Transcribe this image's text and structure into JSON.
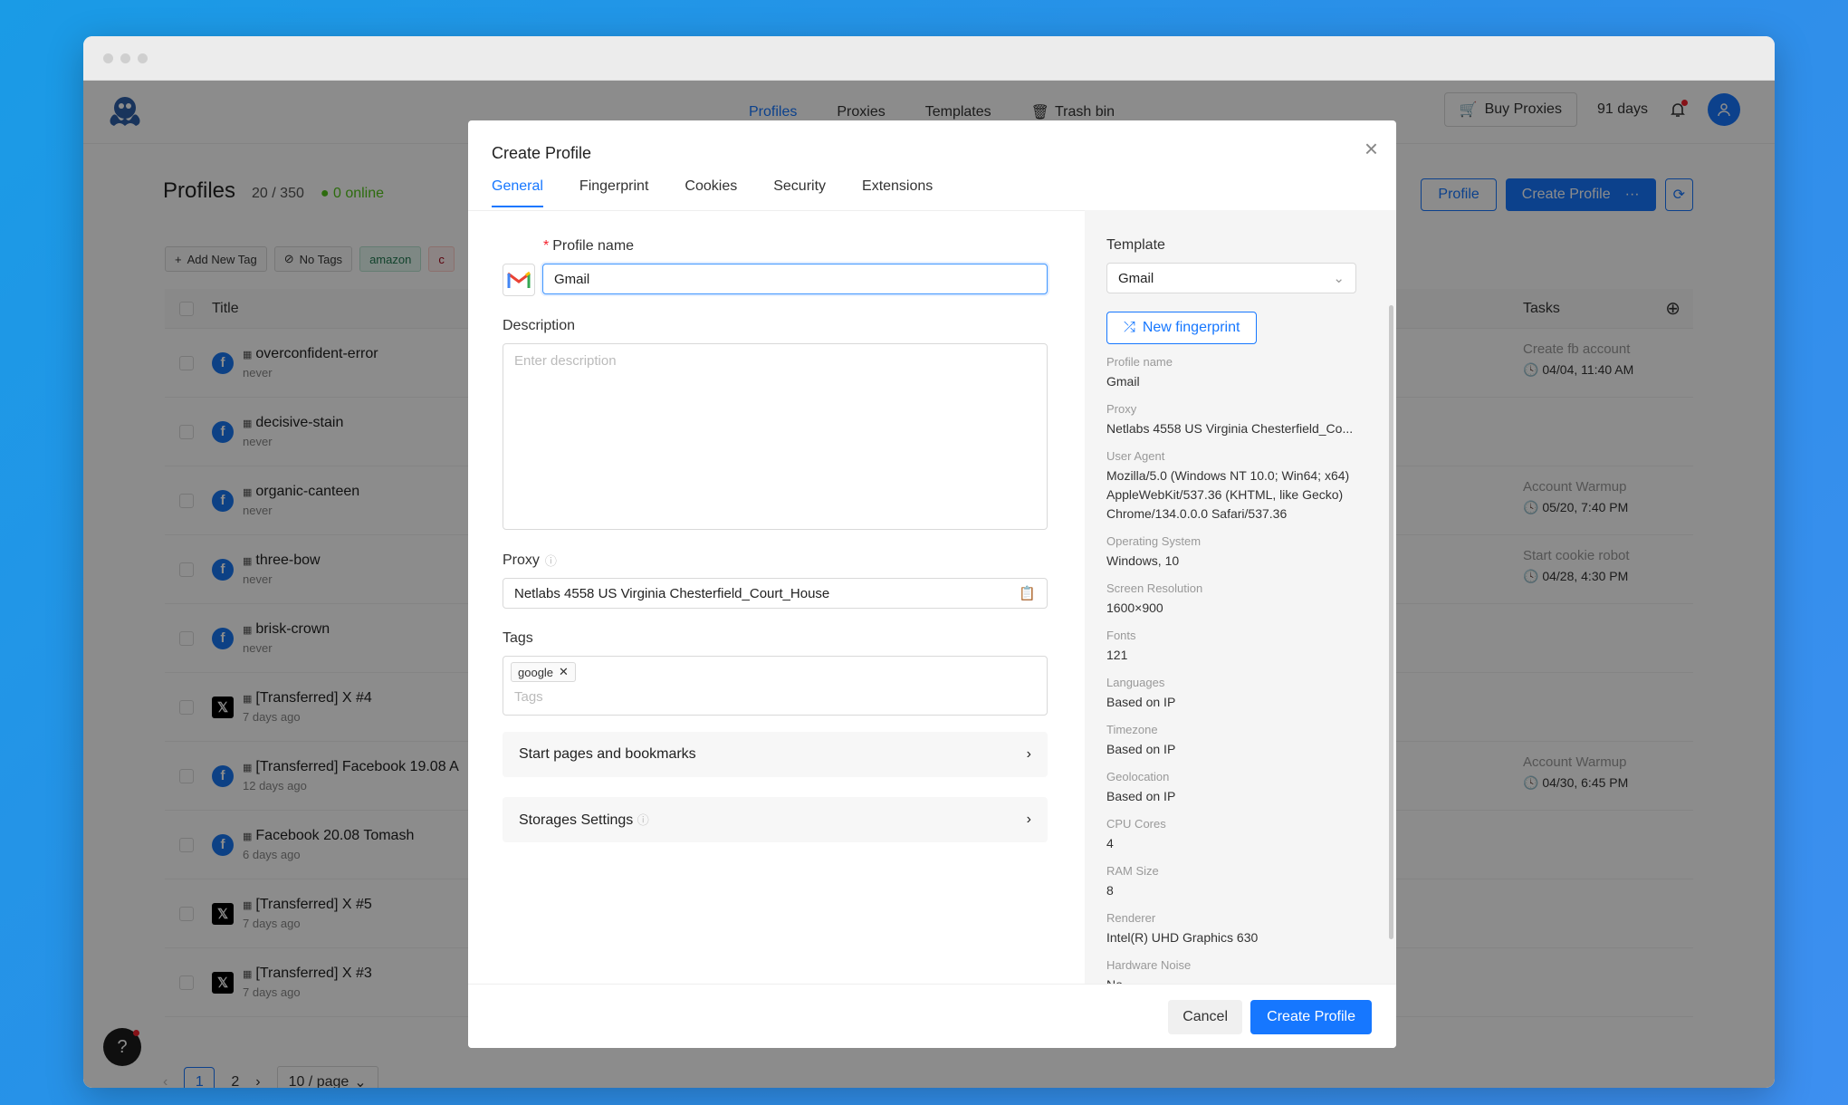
{
  "window": {
    "title": ""
  },
  "nav": {
    "links": [
      "Profiles",
      "Proxies",
      "Templates",
      "Trash bin"
    ],
    "buy_proxies": "Buy Proxies",
    "days": "91 days"
  },
  "page": {
    "title": "Profiles",
    "count": "20 / 350",
    "online": "0 online",
    "profile_btn": "Profile",
    "create_btn": "Create Profile",
    "more_btn": "···"
  },
  "tagsbar": {
    "add": "Add New Tag",
    "notags": "No Tags",
    "amazon": "amazon",
    "partial": "c"
  },
  "table": {
    "col_title": "Title",
    "col_tasks": "Tasks",
    "rows": [
      {
        "title": "overconfident-error",
        "sub": "never",
        "icon": "facebook-icon",
        "task": "Create fb account",
        "task_date": "04/04, 11:40 AM"
      },
      {
        "title": "decisive-stain",
        "sub": "never",
        "icon": "facebook-icon",
        "task": "",
        "task_date": ""
      },
      {
        "title": "organic-canteen",
        "sub": "never",
        "icon": "facebook-icon",
        "task": "Account Warmup",
        "task_date": "05/20, 7:40 PM"
      },
      {
        "title": "three-bow",
        "sub": "never",
        "icon": "facebook-icon",
        "task": "Start cookie robot",
        "task_date": "04/28, 4:30 PM"
      },
      {
        "title": "brisk-crown",
        "sub": "never",
        "icon": "facebook-icon",
        "task": "",
        "task_date": ""
      },
      {
        "title": "[Transferred] X #4",
        "sub": "7 days ago",
        "icon": "x-icon",
        "task": "",
        "task_date": ""
      },
      {
        "title": "[Transferred] Facebook 19.08 A",
        "sub": "12 days ago",
        "icon": "facebook-icon",
        "task": "Account Warmup",
        "task_date": "04/30, 6:45 PM"
      },
      {
        "title": "Facebook 20.08 Tomash",
        "sub": "6 days ago",
        "icon": "facebook-icon",
        "task": "",
        "task_date": ""
      },
      {
        "title": "[Transferred] X #5",
        "sub": "7 days ago",
        "icon": "x-icon",
        "task": "",
        "task_date": ""
      },
      {
        "title": "[Transferred] X #3",
        "sub": "7 days ago",
        "icon": "x-icon",
        "task": "",
        "task_date": ""
      }
    ]
  },
  "pagination": {
    "page1": "1",
    "page2": "2",
    "per_page": "10 / page"
  },
  "modal": {
    "title": "Create Profile",
    "tabs": [
      "General",
      "Fingerprint",
      "Cookies",
      "Security",
      "Extensions"
    ],
    "profile_name_label": "Profile name",
    "profile_name_value": "Gmail",
    "description_label": "Description",
    "description_placeholder": "Enter description",
    "proxy_label": "Proxy",
    "proxy_value": "Netlabs 4558 US Virginia Chesterfield_Court_House",
    "tags_label": "Tags",
    "tag_chip": "google",
    "tags_placeholder": "Tags",
    "start_pages": "Start pages and bookmarks",
    "storages": "Storages Settings",
    "cancel": "Cancel",
    "create": "Create Profile"
  },
  "summary": {
    "template_label": "Template",
    "template_value": "Gmail",
    "new_fingerprint": "New fingerprint",
    "items": [
      {
        "k": "Profile name",
        "v": "Gmail"
      },
      {
        "k": "Proxy",
        "v": "Netlabs 4558 US Virginia Chesterfield_Co..."
      },
      {
        "k": "User Agent",
        "v": "Mozilla/5.0 (Windows NT 10.0; Win64; x64) AppleWebKit/537.36 (KHTML, like Gecko) Chrome/134.0.0.0 Safari/537.36"
      },
      {
        "k": "Operating System",
        "v": "Windows, 10"
      },
      {
        "k": "Screen Resolution",
        "v": "1600×900"
      },
      {
        "k": "Fonts",
        "v": "121"
      },
      {
        "k": "Languages",
        "v": "Based on IP"
      },
      {
        "k": "Timezone",
        "v": "Based on IP"
      },
      {
        "k": "Geolocation",
        "v": "Based on IP"
      },
      {
        "k": "CPU Cores",
        "v": "4"
      },
      {
        "k": "RAM Size",
        "v": "8"
      },
      {
        "k": "Renderer",
        "v": "Intel(R) UHD Graphics 630"
      },
      {
        "k": "Hardware Noise",
        "v": "No"
      }
    ]
  },
  "colors": {
    "accent": "#1677ff",
    "online": "#52c41a"
  }
}
